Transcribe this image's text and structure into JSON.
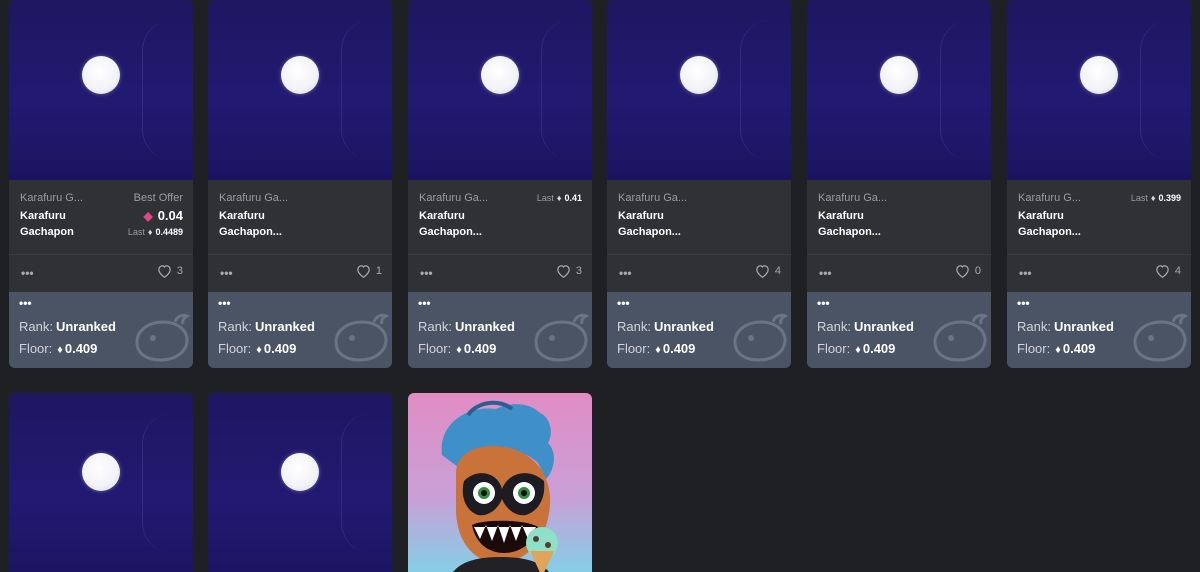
{
  "colors": {
    "page_bg": "#1f2023",
    "card_bg": "#2f3135",
    "rank_bg": "#4b5465",
    "nft_bg": "#221a72",
    "eth_pink": "#e0478a"
  },
  "icons": {
    "more": "ellipsis-icon",
    "like": "heart-icon",
    "eth": "ethereum-icon",
    "rarity": "whale-icon"
  },
  "cards": [
    {
      "collection": "Karafuru G...",
      "name": "Karafuru Gachapon",
      "offer_label": "Best Offer",
      "offer_price": "0.04",
      "last_label": "Last",
      "last_price": "0.4489",
      "likes": "3",
      "rank_label": "Rank:",
      "rank": "Unranked",
      "floor_label": "Floor:",
      "floor": "0.409"
    },
    {
      "collection": "Karafuru Ga...",
      "name": "Karafuru Gachapon...",
      "likes": "1",
      "rank_label": "Rank:",
      "rank": "Unranked",
      "floor_label": "Floor:",
      "floor": "0.409"
    },
    {
      "collection": "Karafuru Ga...",
      "name": "Karafuru Gachapon...",
      "last_label": "Last",
      "last_price": "0.41",
      "likes": "3",
      "rank_label": "Rank:",
      "rank": "Unranked",
      "floor_label": "Floor:",
      "floor": "0.409"
    },
    {
      "collection": "Karafuru Ga...",
      "name": "Karafuru Gachapon...",
      "likes": "4",
      "rank_label": "Rank:",
      "rank": "Unranked",
      "floor_label": "Floor:",
      "floor": "0.409"
    },
    {
      "collection": "Karafuru Ga...",
      "name": "Karafuru Gachapon...",
      "likes": "0",
      "rank_label": "Rank:",
      "rank": "Unranked",
      "floor_label": "Floor:",
      "floor": "0.409"
    },
    {
      "collection": "Karafuru G...",
      "name": "Karafuru Gachapon...",
      "last_label": "Last",
      "last_price": "0.399",
      "likes": "4",
      "rank_label": "Rank:",
      "rank": "Unranked",
      "floor_label": "Floor:",
      "floor": "0.409"
    }
  ]
}
